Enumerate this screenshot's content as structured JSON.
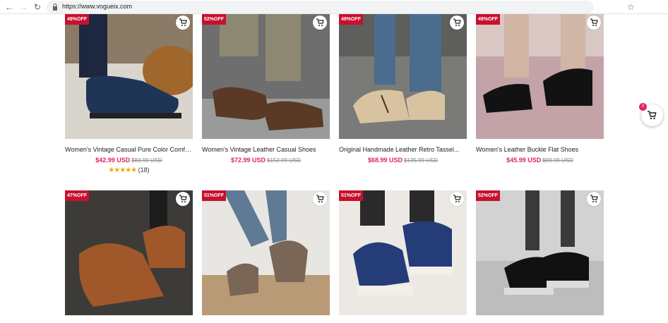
{
  "browser": {
    "url": "https://www.vogueix.com",
    "back_icon": "arrow-left-icon",
    "forward_icon": "arrow-right-icon",
    "reload_icon": "reload-icon",
    "bookmark_icon": "star-icon"
  },
  "floating_cart": {
    "count": "0",
    "icon": "cart-icon"
  },
  "colors": {
    "badge": "#c8102e",
    "price": "#e0245e",
    "star": "#f7a600"
  },
  "products": [
    {
      "badge": "49%OFF",
      "title": "Women's Vintage Casual Pure Color Comfo...",
      "price": "$42.99 USD",
      "old_price": "$83.99 USD",
      "stars": "★★★★★",
      "reviews": "(18)"
    },
    {
      "badge": "52%OFF",
      "title": "Women's Vintage Leather Casual Shoes",
      "price": "$72.99 USD",
      "old_price": "$152.99 USD"
    },
    {
      "badge": "49%OFF",
      "title": "Original Handmade Leather Retro Tassel...",
      "price": "$68.99 USD",
      "old_price": "$135.99 USD"
    },
    {
      "badge": "49%OFF",
      "title": "Women's Leather Buckle Flat Shoes",
      "price": "$45.99 USD",
      "old_price": "$89.99 USD"
    },
    {
      "badge": "47%OFF"
    },
    {
      "badge": "51%OFF"
    },
    {
      "badge": "51%OFF"
    },
    {
      "badge": "52%OFF"
    }
  ]
}
